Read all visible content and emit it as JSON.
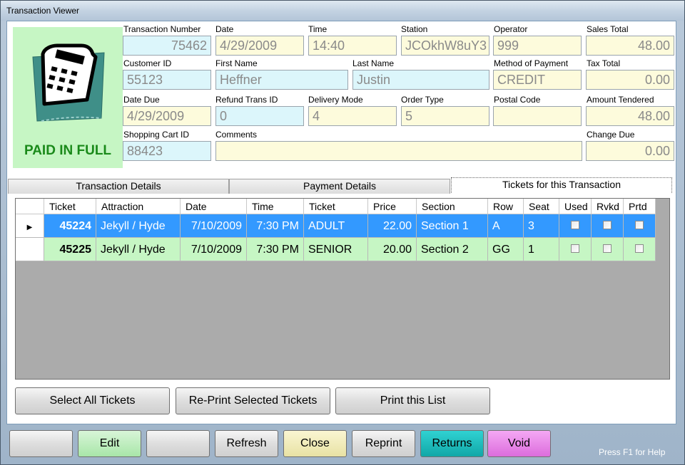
{
  "window": {
    "title": "Transaction Viewer"
  },
  "status": {
    "text": "PAID IN FULL"
  },
  "fields": {
    "transaction_number": {
      "label": "Transaction Number",
      "value": "75462"
    },
    "date": {
      "label": "Date",
      "value": "4/29/2009"
    },
    "time": {
      "label": "Time",
      "value": "14:40"
    },
    "station": {
      "label": "Station",
      "value": "JCOkhW8uY3"
    },
    "operator": {
      "label": "Operator",
      "value": "999"
    },
    "sales_total": {
      "label": "Sales Total",
      "value": "48.00"
    },
    "customer_id": {
      "label": "Customer ID",
      "value": "55123"
    },
    "first_name": {
      "label": "First Name",
      "value": "Heffner"
    },
    "last_name": {
      "label": "Last Name",
      "value": "Justin"
    },
    "method_of_payment": {
      "label": "Method of Payment",
      "value": "CREDIT"
    },
    "tax_total": {
      "label": "Tax Total",
      "value": "0.00"
    },
    "date_due": {
      "label": "Date Due",
      "value": "4/29/2009"
    },
    "refund_trans_id": {
      "label": "Refund Trans ID",
      "value": "0"
    },
    "delivery_mode": {
      "label": "Delivery Mode",
      "value": "4"
    },
    "order_type": {
      "label": "Order Type",
      "value": "5"
    },
    "postal_code": {
      "label": "Postal Code",
      "value": ""
    },
    "amount_tendered": {
      "label": "Amount Tendered",
      "value": "48.00"
    },
    "shopping_cart_id": {
      "label": "Shopping Cart ID",
      "value": "88423"
    },
    "comments": {
      "label": "Comments",
      "value": ""
    },
    "change_due": {
      "label": "Change Due",
      "value": "0.00"
    }
  },
  "tabs": [
    {
      "label": "Transaction Details"
    },
    {
      "label": "Payment Details"
    },
    {
      "label": "Tickets for this Transaction"
    }
  ],
  "grid": {
    "columns": [
      "Ticket",
      "Attraction",
      "Date",
      "Time",
      "Ticket",
      "Price",
      "Section",
      "Row",
      "Seat",
      "Used",
      "Rvkd",
      "Prtd"
    ],
    "rows": [
      {
        "ticket": "45224",
        "attraction": "Jekyll / Hyde",
        "date": "7/10/2009",
        "time": "7:30 PM",
        "type": "ADULT",
        "price": "22.00",
        "section": "Section 1",
        "row": "A",
        "seat": "3"
      },
      {
        "ticket": "45225",
        "attraction": "Jekyll / Hyde",
        "date": "7/10/2009",
        "time": "7:30 PM",
        "type": "SENIOR",
        "price": "20.00",
        "section": "Section 2",
        "row": "GG",
        "seat": "1"
      }
    ]
  },
  "ticket_actions": {
    "select_all": "Select All Tickets",
    "reprint_selected": "Re-Print Selected Tickets",
    "print_list": "Print this List"
  },
  "toolbar": {
    "edit": "Edit",
    "refresh": "Refresh",
    "close": "Close",
    "reprint": "Reprint",
    "returns": "Returns",
    "void": "Void"
  },
  "help": {
    "text": "Press F1 for Help"
  }
}
